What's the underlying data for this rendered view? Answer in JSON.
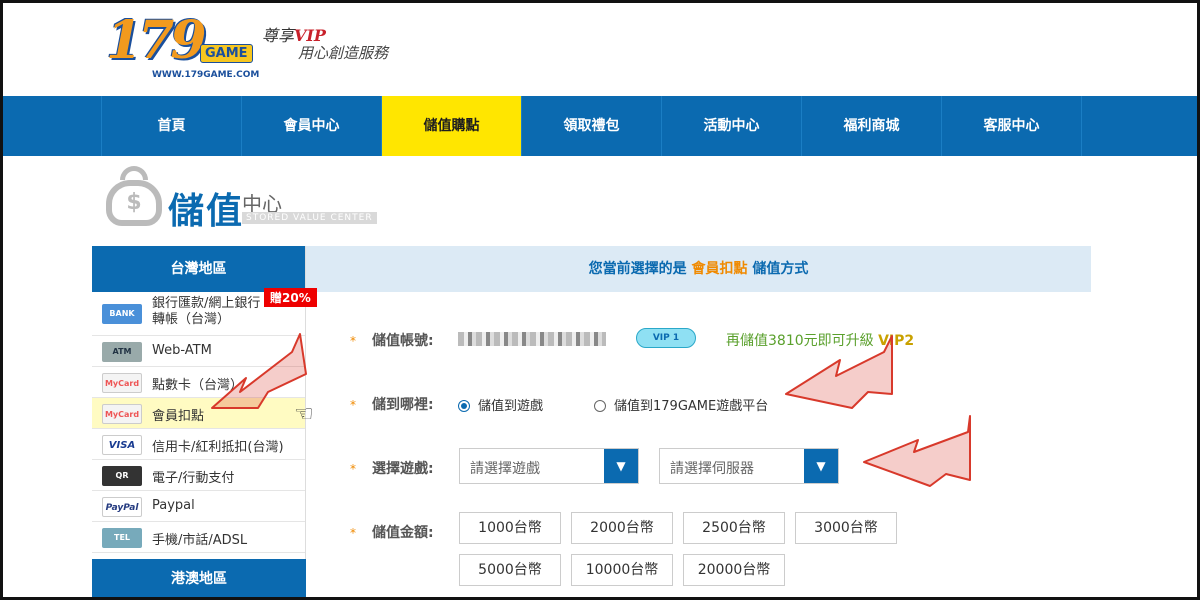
{
  "logo": {
    "digits": "179",
    "game": "GAME",
    "url": "WWW.179GAME.COM"
  },
  "slogan": {
    "line1_a": "尊享",
    "line1_b": "VIP",
    "line2": "用心創造服務"
  },
  "nav": [
    "首頁",
    "會員中心",
    "儲值購點",
    "領取禮包",
    "活動中心",
    "福利商城",
    "客服中心"
  ],
  "banner": {
    "icon_symbol": "$",
    "title": "儲值",
    "subtitle": "中心",
    "english": "STORED VALUE CENTER"
  },
  "sidebar": {
    "region1": "台灣地區",
    "promo": "贈20%",
    "items": [
      {
        "icon_text": "BANK",
        "label": "銀行匯款/網上銀行轉帳（台灣）"
      },
      {
        "icon_text": "ATM",
        "label": "Web-ATM"
      },
      {
        "icon_text": "MyCard",
        "label": "點數卡（台灣）"
      },
      {
        "icon_text": "MyCard",
        "label": "會員扣點"
      },
      {
        "icon_text": "VISA",
        "label": "信用卡/紅利抵扣(台灣)"
      },
      {
        "icon_text": "QR",
        "label": "電子/行動支付"
      },
      {
        "icon_text": "PayPal",
        "label": "Paypal"
      },
      {
        "icon_text": "TEL",
        "label": "手機/市話/ADSL"
      }
    ],
    "region2": "港澳地區"
  },
  "main": {
    "head_a": "您當前選擇的是",
    "head_b": "會員扣點",
    "head_c": "儲值方式",
    "account_label": "儲值帳號:",
    "vip_badge": "VIP 1",
    "upgrade_a": "再儲值3810元即可升級",
    "upgrade_b": "VIP2",
    "where_label": "儲到哪裡:",
    "radio1": "儲值到遊戲",
    "radio2": "儲值到179GAME遊戲平台",
    "game_label": "選擇遊戲:",
    "game_placeholder": "請選擇遊戲",
    "server_placeholder": "請選擇伺服器",
    "amount_label": "儲值金額:",
    "amounts": [
      "1000台幣",
      "2000台幣",
      "2500台幣",
      "3000台幣",
      "5000台幣",
      "10000台幣",
      "20000台幣"
    ],
    "star": "*"
  },
  "colors": {
    "nav": "#0b6ab0",
    "active_tab": "#ffe600",
    "accent": "#f08a00",
    "arrow": "#d8392b"
  }
}
